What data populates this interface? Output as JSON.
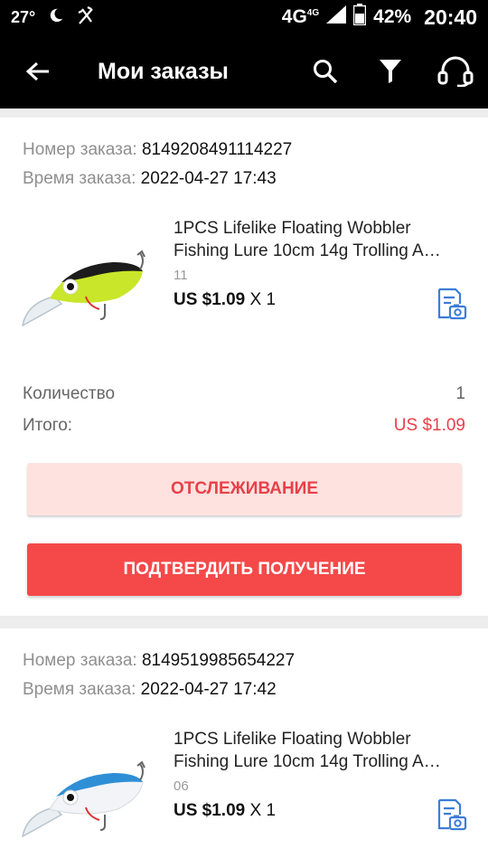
{
  "status_bar": {
    "temperature": "27°",
    "network": "4G",
    "network_small": "4G",
    "battery": "42%",
    "time": "20:40"
  },
  "toolbar": {
    "title": "Мои заказы",
    "icons": [
      "back-arrow-icon",
      "search-icon",
      "filter-icon",
      "headset-icon"
    ]
  },
  "orders": [
    {
      "number_label": "Номер заказа:",
      "number": "8149208491114227",
      "time_label": "Время заказа:",
      "time": "2022-04-27 17:43",
      "product": {
        "title_line1": "1PCS Lifelike Floating Wobbler",
        "title_line2": "Fishing Lure 10cm 14g Trolling A…",
        "variant": "11",
        "price": "US $1.09",
        "qty": "X 1",
        "color": "yellow-green-black"
      },
      "quantity_label": "Количество",
      "quantity": "1",
      "total_label": "Итого:",
      "total": "US $1.09",
      "track_button": "ОТСЛЕЖИВАНИЕ",
      "confirm_button": "ПОДТВЕРДИТЬ ПОЛУЧЕНИЕ"
    },
    {
      "number_label": "Номер заказа:",
      "number": "8149519985654227",
      "time_label": "Время заказа:",
      "time": "2022-04-27 17:42",
      "product": {
        "title_line1": "1PCS Lifelike Floating Wobbler",
        "title_line2": "Fishing Lure 10cm 14g Trolling A…",
        "variant": "06",
        "price": "US $1.09",
        "qty": "X 1",
        "color": "blue-white"
      }
    }
  ],
  "colors": {
    "accent": "#f54949",
    "accent_light": "#fde2df",
    "price_red": "#e8404a"
  }
}
